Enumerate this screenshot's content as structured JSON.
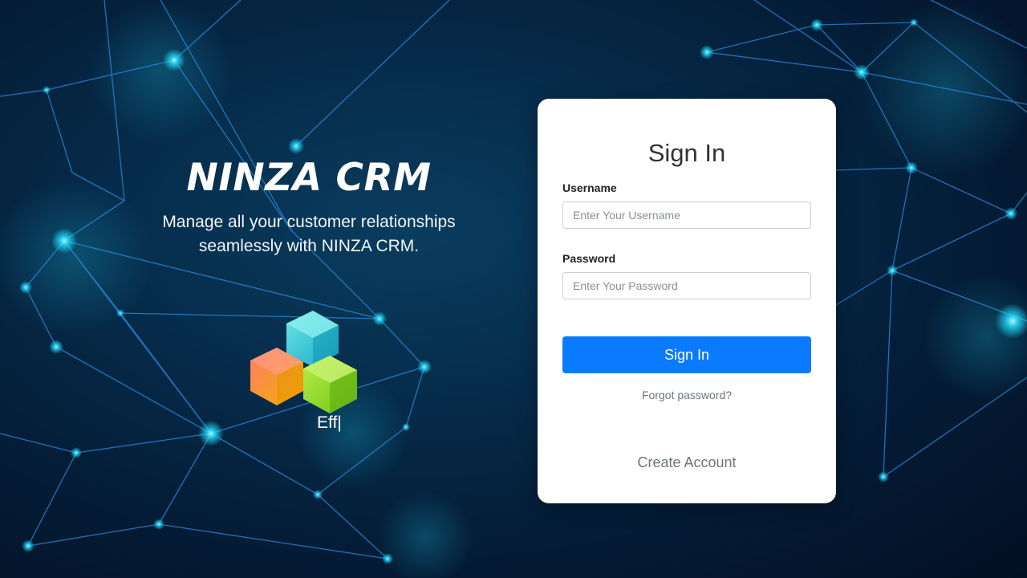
{
  "brand": {
    "title": "NINZA CRM",
    "tagline": "Manage all your customer relationships seamlessly with NINZA CRM."
  },
  "logo": {
    "text": "Eff|",
    "icon": "colored-cubes-logo"
  },
  "login": {
    "title": "Sign In",
    "username_label": "Username",
    "username_placeholder": "Enter Your Username",
    "username_value": "",
    "password_label": "Password",
    "password_placeholder": "Enter Your Password",
    "password_value": "",
    "signin_button": "Sign In",
    "forgot_link": "Forgot password?",
    "create_account_link": "Create Account"
  },
  "colors": {
    "primary_button": "#0a7bff",
    "background_dark": "#041c36",
    "network_glow": "#22e0ff",
    "link_gray": "#6c757d"
  }
}
